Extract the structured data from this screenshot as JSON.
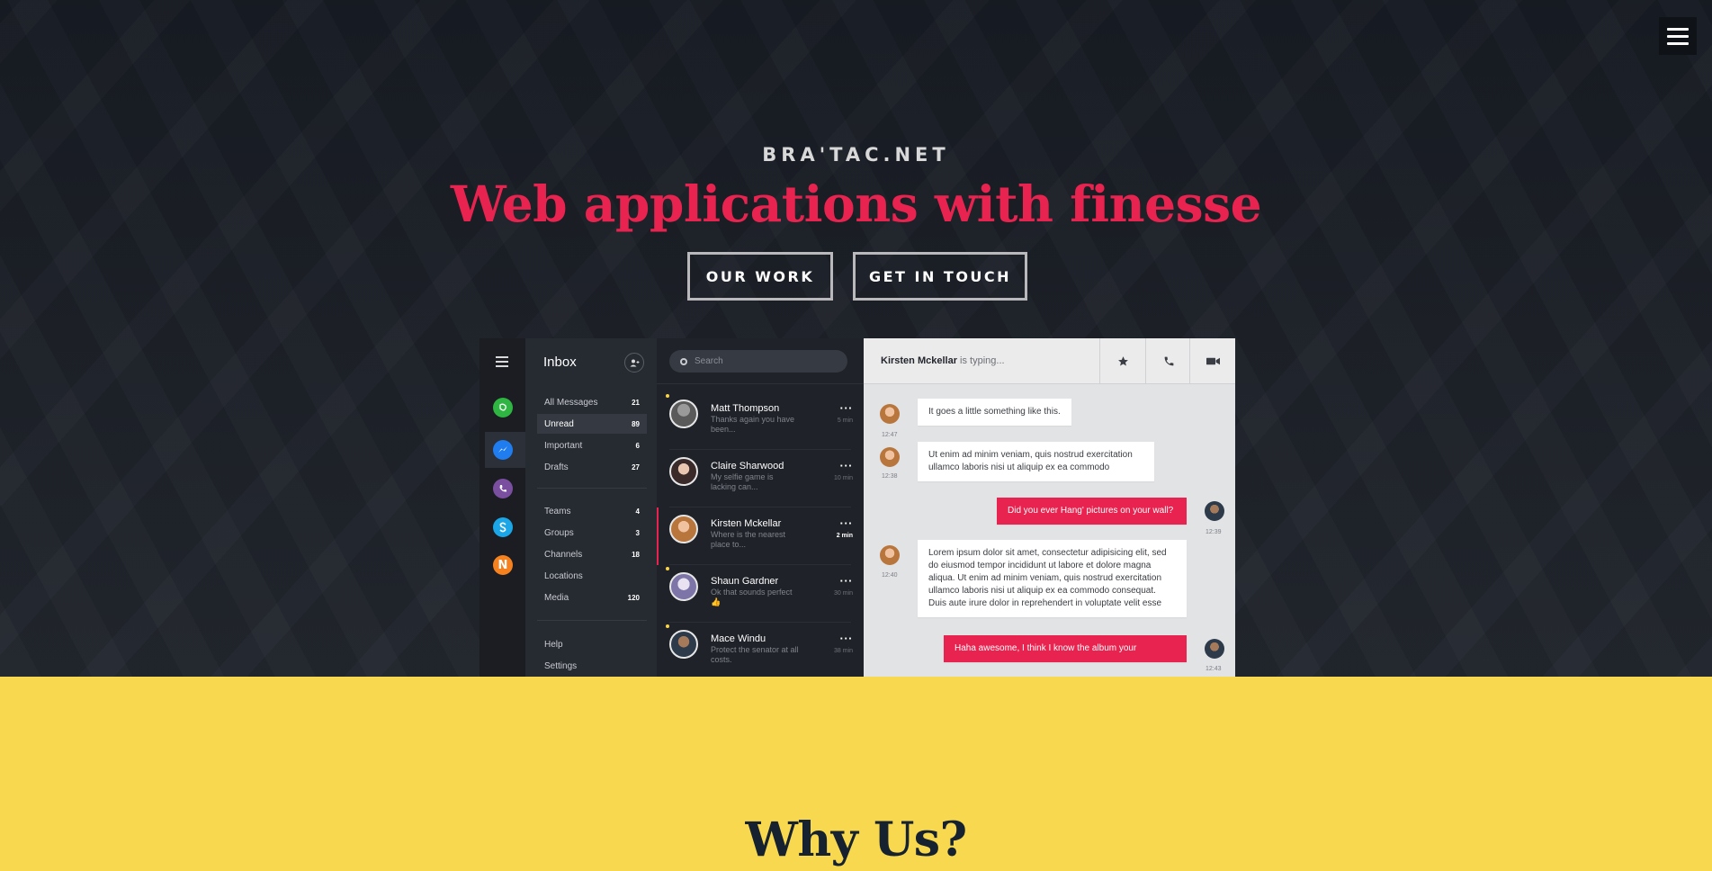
{
  "hero": {
    "brand": "BRA'TAC.NET",
    "headline": "Web applications with finesse",
    "buttons": {
      "our_work": "OUR WORK",
      "get_in_touch": "GET IN TOUCH"
    }
  },
  "mockup": {
    "inbox_title": "Inbox",
    "folders": [
      {
        "label": "All Messages",
        "count": "21"
      },
      {
        "label": "Unread",
        "count": "89"
      },
      {
        "label": "Important",
        "count": "6"
      },
      {
        "label": "Drafts",
        "count": "27"
      },
      {
        "label": "Teams",
        "count": "4"
      },
      {
        "label": "Groups",
        "count": "3"
      },
      {
        "label": "Channels",
        "count": "18"
      },
      {
        "label": "Locations",
        "count": ""
      },
      {
        "label": "Media",
        "count": "120"
      }
    ],
    "footer_links": {
      "help": "Help",
      "settings": "Settings"
    },
    "search_placeholder": "Search",
    "conversations": [
      {
        "name": "Matt Thompson",
        "preview": "Thanks again you have been...",
        "time": "5 min"
      },
      {
        "name": "Claire Sharwood",
        "preview": "My selfie game is lacking can...",
        "time": "10 min"
      },
      {
        "name": "Kirsten Mckellar",
        "preview": "Where is the nearest place to...",
        "time": "2 min"
      },
      {
        "name": "Shaun Gardner",
        "preview": "Ok that sounds perfect 👍",
        "time": "30 min"
      },
      {
        "name": "Mace Windu",
        "preview": "Protect the senator at all costs.",
        "time": "38 min"
      }
    ],
    "chat": {
      "contact": "Kirsten Mckellar",
      "status": "is typing...",
      "messages": [
        {
          "text": "It goes a little something like this.",
          "time": "12:47"
        },
        {
          "text": "Ut enim ad minim veniam, quis nostrud exercitation ullamco laboris nisi ut aliquip ex ea commodo",
          "time": "12:38"
        },
        {
          "text": "Did you ever Hang' pictures on your wall?",
          "time": "12:39"
        },
        {
          "text": "Lorem ipsum dolor sit amet, consectetur adipisicing elit, sed do eiusmod tempor incididunt ut labore et dolore magna aliqua. Ut enim ad minim veniam, quis nostrud exercitation ullamco laboris nisi ut aliquip ex ea commodo consequat. Duis aute irure dolor in reprehendert in voluptate velit esse",
          "time": "12:40"
        },
        {
          "text": "Haha awesome,  I think I know the album your",
          "time": "12:43"
        }
      ]
    },
    "app_icons": [
      "whatsapp-icon",
      "messenger-icon",
      "viber-icon",
      "skype-icon",
      "n-app-icon"
    ],
    "app_icon_glyphs": {
      "n": "N"
    },
    "colors": {
      "accent": "#e8234f",
      "yellow": "#f7d84f",
      "dark": "#1b1f27"
    }
  },
  "section": {
    "why_us": "Why Us?"
  }
}
